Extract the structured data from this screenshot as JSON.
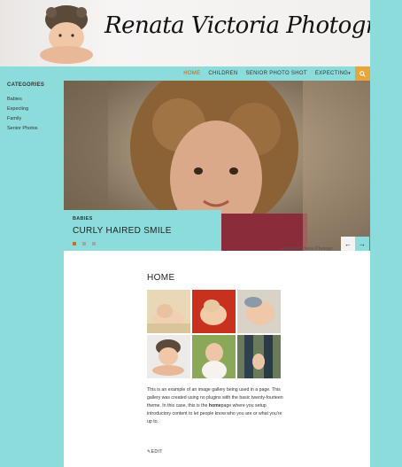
{
  "site": {
    "title": "Renata Victoria Photography"
  },
  "nav": {
    "items": [
      {
        "label": "HOME",
        "active": true
      },
      {
        "label": "CHILDREN",
        "active": false
      },
      {
        "label": "SENIOR PHOTO SHOT",
        "active": false
      },
      {
        "label": "EXPECTING",
        "active": false
      }
    ],
    "search_icon": "search-icon"
  },
  "sidebar": {
    "title": "CATEGORIES",
    "items": [
      "Babies",
      "Expecting",
      "Family",
      "Senior Photos"
    ]
  },
  "slider": {
    "tag": "BABIES",
    "title": "CURLY HAIRED SMILE",
    "watermark": "Renata Victoria Photogr",
    "active_dot": 0,
    "dot_count": 3
  },
  "page": {
    "title": "HOME",
    "intro_part1": "This is an example of an image gallery being used in a page. This gallery was created using no plugins with the basic twenty-fourteen theme. In this case, this is the ",
    "intro_bold": "home",
    "intro_part2": "page where you setup introductory content to let people know who you are or what you're up to.",
    "edit_label": "EDIT"
  },
  "colors": {
    "accent": "#8ddcdc",
    "highlight": "#e8a53c",
    "active_nav": "#b8640a"
  }
}
